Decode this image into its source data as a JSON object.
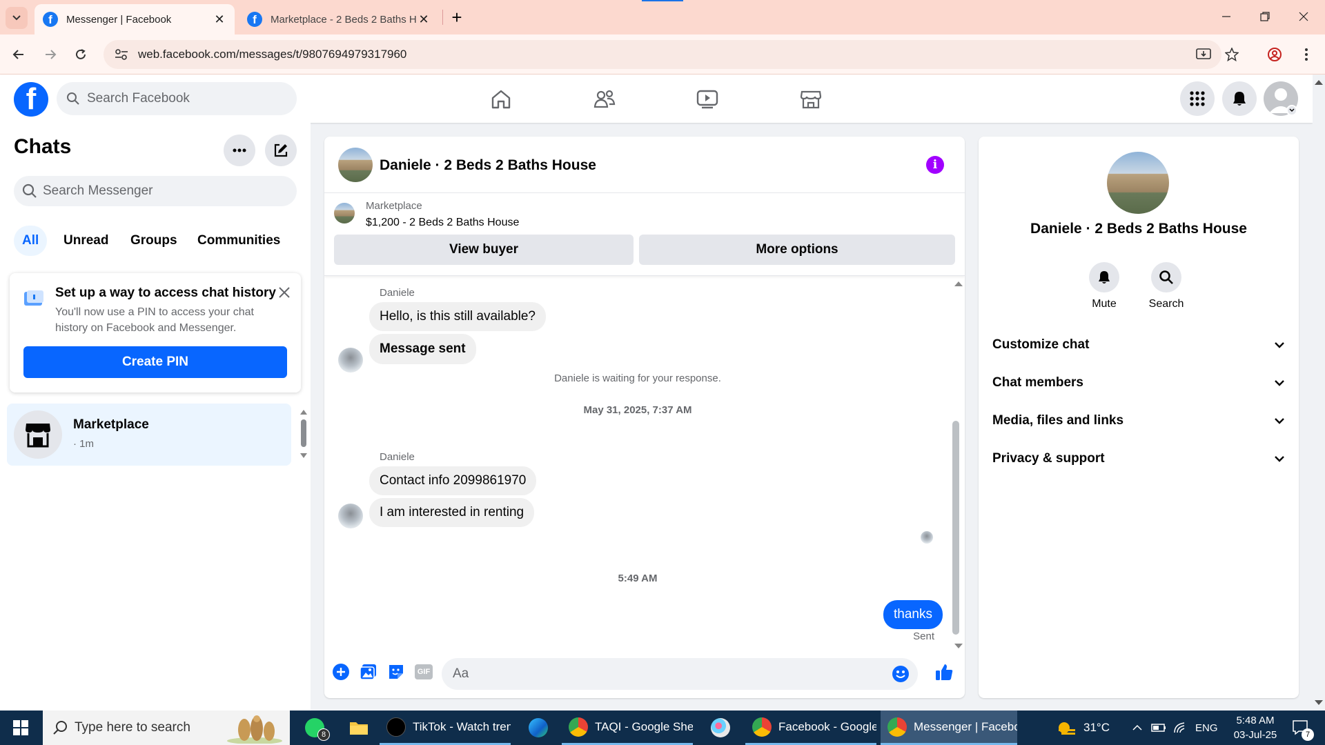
{
  "browser": {
    "tabs": [
      {
        "title": "Messenger | Facebook",
        "active": true
      },
      {
        "title": "Marketplace - 2 Beds 2 Baths H",
        "active": false
      }
    ],
    "url": "web.facebook.com/messages/t/9807694979317960"
  },
  "header": {
    "search_placeholder": "Search Facebook"
  },
  "sidebar": {
    "title": "Chats",
    "search_placeholder": "Search Messenger",
    "filters": [
      "All",
      "Unread",
      "Groups",
      "Communities"
    ],
    "pin_card": {
      "title": "Set up a way to access chat history",
      "description": "You'll now use a PIN to access your chat history on Facebook and Messenger.",
      "button": "Create PIN"
    },
    "conversation": {
      "name": "Marketplace",
      "time": "· 1m"
    }
  },
  "chat": {
    "title": "Daniele · 2 Beds 2 Baths House",
    "marketplace_label": "Marketplace",
    "listing": "$1,200 - 2 Beds 2 Baths House",
    "view_buyer": "View buyer",
    "more_options": "More options",
    "messages": {
      "sender1": "Daniele",
      "m1": "Hello, is this still available?",
      "m2": "Message sent",
      "waiting": "Daniele is waiting for your response.",
      "date1": "May 31, 2025, 7:37 AM",
      "sender2": "Daniele",
      "m3": "Contact info 2099861970",
      "m4": "I am interested in renting",
      "date2": "5:49 AM",
      "out1": "thanks",
      "status": "Sent"
    },
    "input_placeholder": "Aa",
    "gif_label": "GIF"
  },
  "details": {
    "name": "Daniele · 2 Beds 2 Baths House",
    "mute": "Mute",
    "search": "Search",
    "sections": [
      "Customize chat",
      "Chat members",
      "Media, files and links",
      "Privacy & support"
    ]
  },
  "taskbar": {
    "search_placeholder": "Type here to search",
    "whatsapp_badge": "8",
    "apps": [
      "TikTok - Watch tren...",
      "TAQI - Google Shee...",
      "Facebook - Google ...",
      "Messenger | Facebo..."
    ],
    "weather": "31°C",
    "language": "ENG",
    "time": "5:48 AM",
    "date": "03-Jul-25",
    "notifications": "7"
  },
  "colors": {
    "brand": "#0866ff",
    "info": "#a100ff"
  }
}
